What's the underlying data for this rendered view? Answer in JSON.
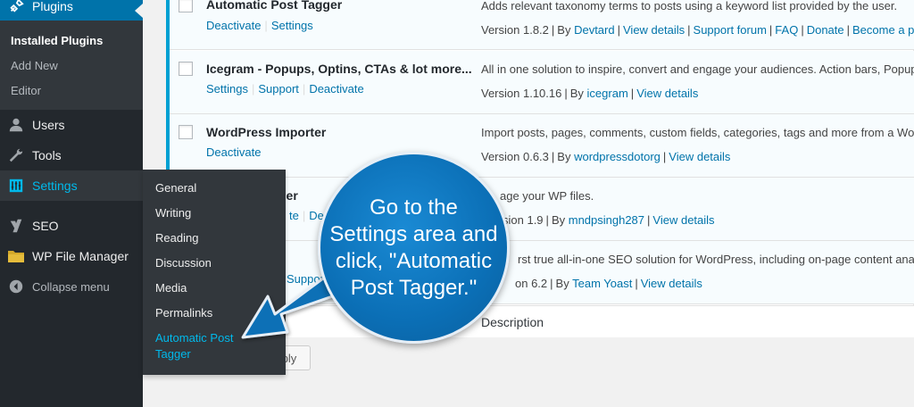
{
  "sidebar": {
    "plugins_label": "Plugins",
    "plugins_sub": [
      "Installed Plugins",
      "Add New",
      "Editor"
    ],
    "items": [
      {
        "label": "Users",
        "icon": "users-icon"
      },
      {
        "label": "Tools",
        "icon": "wrench-icon"
      },
      {
        "label": "Settings",
        "icon": "settings-icon"
      },
      {
        "label": "SEO",
        "icon": "yoast-icon"
      },
      {
        "label": "WP File Manager",
        "icon": "folder-icon"
      },
      {
        "label": "Collapse menu",
        "icon": "collapse-icon"
      }
    ]
  },
  "flyout": [
    "General",
    "Writing",
    "Reading",
    "Discussion",
    "Media",
    "Permalinks",
    "Automatic Post Tagger"
  ],
  "plugins": [
    {
      "name": "Automatic Post Tagger",
      "actions": [
        "Deactivate",
        "Settings"
      ],
      "description": "Adds relevant taxonomy terms to posts using a keyword list provided by the user.",
      "version": "Version 1.8.2",
      "by": "By",
      "author": "Devtard",
      "links": [
        "View details",
        "Support forum",
        "FAQ",
        "Donate",
        "Become a p"
      ]
    },
    {
      "name": "Icegram - Popups, Optins, CTAs & lot more...",
      "actions": [
        "Settings",
        "Support",
        "Deactivate"
      ],
      "description": "All in one solution to inspire, convert and engage your audiences. Action bars, Popup",
      "version": "Version 1.10.16",
      "by": "By",
      "author": "icegram",
      "links": [
        "View details"
      ]
    },
    {
      "name": "WordPress Importer",
      "actions": [
        "Deactivate"
      ],
      "description": "Import posts, pages, comments, custom fields, categories, tags and more from a Wor",
      "version": "Version 0.6.3",
      "by": "By",
      "author": "wordpressdotorg",
      "links": [
        "View details"
      ]
    },
    {
      "name": "ger",
      "actions": [
        "te",
        "De"
      ],
      "description": "age your WP files.",
      "version": "sion 1.9",
      "by": "By",
      "author": "mndpsingh287",
      "links": [
        "View details"
      ]
    },
    {
      "name": "",
      "actions": [
        "Support"
      ],
      "description": "rst true all-in-one SEO solution for WordPress, including on-page content analy",
      "version": "on 6.2",
      "by": "By",
      "author": "Team Yoast",
      "links": [
        "View details"
      ]
    }
  ],
  "table_footer": {
    "description_label": "Description"
  },
  "apply_button": "ply",
  "callout": {
    "text": "Go to the Settings area and click, \"Automatic Post Tagger.\""
  },
  "colors": {
    "accent": "#0073aa",
    "highlight": "#00b9eb",
    "sidebar": "#23282d",
    "callout": "#0b6fb6"
  }
}
